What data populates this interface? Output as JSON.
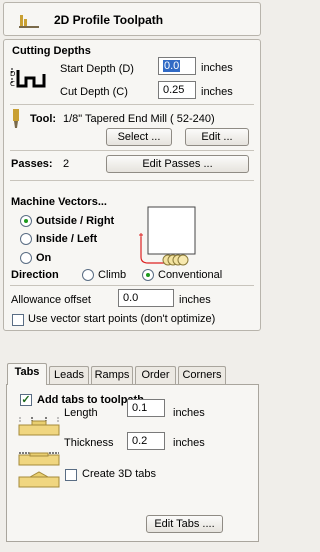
{
  "header": {
    "title": "2D Profile Toolpath",
    "icon": "profile-toolpath-icon"
  },
  "cutting_depths": {
    "heading": "Cutting Depths",
    "start_depth_label": "Start Depth (D)",
    "start_depth_value": "0.0",
    "cut_depth_label": "Cut Depth (C)",
    "cut_depth_value": "0.25",
    "units": "inches"
  },
  "tool": {
    "label": "Tool:",
    "name": "1/8\" Tapered End Mill ( 52-240)",
    "select_button": "Select ...",
    "edit_button": "Edit ..."
  },
  "passes": {
    "label": "Passes:",
    "count": "2",
    "edit_button": "Edit Passes ..."
  },
  "machine_vectors": {
    "heading": "Machine Vectors...",
    "options": [
      "Outside / Right",
      "Inside / Left",
      "On"
    ],
    "selected": "Outside / Right",
    "direction_label": "Direction",
    "direction_options": [
      "Climb",
      "Conventional"
    ],
    "direction_selected": "Conventional",
    "allowance_label": "Allowance offset",
    "allowance_value": "0.0",
    "units": "inches",
    "start_points_label": "Use vector start points (don't optimize)",
    "start_points_checked": false
  },
  "tabs_bar": [
    "Tabs",
    "Leads",
    "Ramps",
    "Order",
    "Corners"
  ],
  "active_tab": "Tabs",
  "tabs_panel": {
    "add_tabs_label": "Add tabs to toolpath",
    "add_tabs_checked": true,
    "length_label": "Length",
    "length_value": "0.1",
    "thickness_label": "Thickness",
    "thickness_value": "0.2",
    "units": "inches",
    "create_3d_label": "Create 3D tabs",
    "create_3d_checked": false,
    "edit_tabs_button": "Edit Tabs ...."
  },
  "colors": {
    "accent_green": "#1d9a1d",
    "selection_blue": "#316ac5",
    "tool_gold": "#c9a033"
  }
}
